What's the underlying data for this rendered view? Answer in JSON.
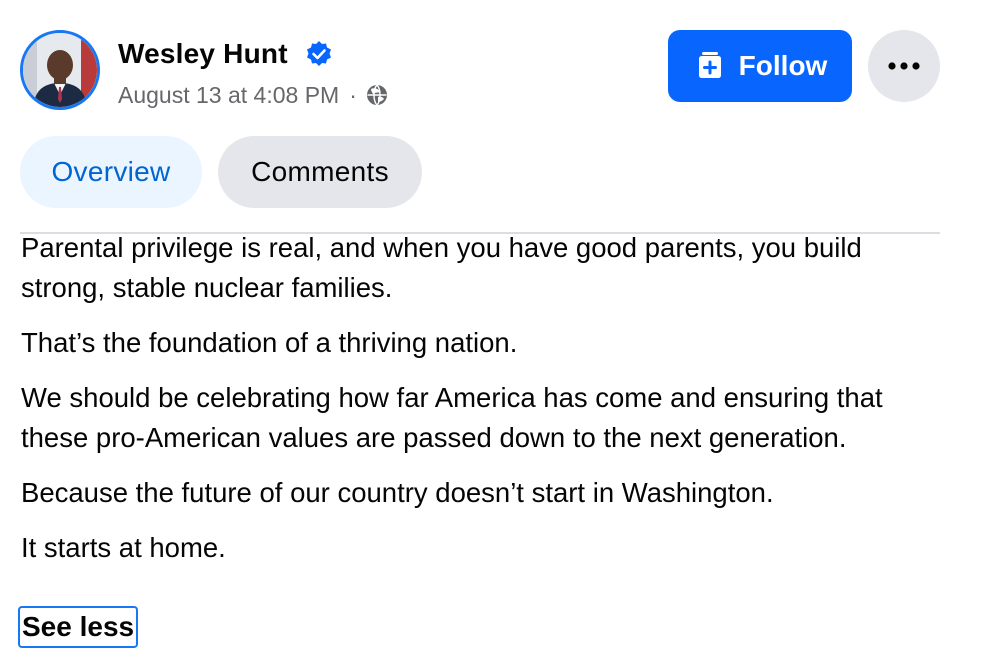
{
  "post": {
    "author": {
      "name": "Wesley Hunt",
      "verified": true
    },
    "timestamp": "August 13 at 4:08 PM",
    "separator": "·",
    "privacy_icon": "globe-icon",
    "follow_label": "Follow",
    "follow_icon": "add-page-icon",
    "more_icon": "more-horizontal-icon"
  },
  "tabs": [
    {
      "label": "Overview",
      "selected": true
    },
    {
      "label": "Comments",
      "selected": false
    }
  ],
  "body": {
    "paragraphs": [
      "Parental privilege is real, and when you have good parents, you build strong, stable nuclear families.",
      "That’s the foundation of a thriving nation.",
      "We should be celebrating how far America has come and ensuring that these pro-American values are passed down to the next generation.",
      "Because the future of our country doesn’t start in Washington.",
      "It starts at home."
    ],
    "see_less_label": "See less"
  },
  "colors": {
    "accent": "#0866ff",
    "tab_selected_bg": "#ebf5ff",
    "tab_selected_text": "#0064d1",
    "secondary_bg": "#e4e6eb",
    "meta_text": "#65676b"
  }
}
